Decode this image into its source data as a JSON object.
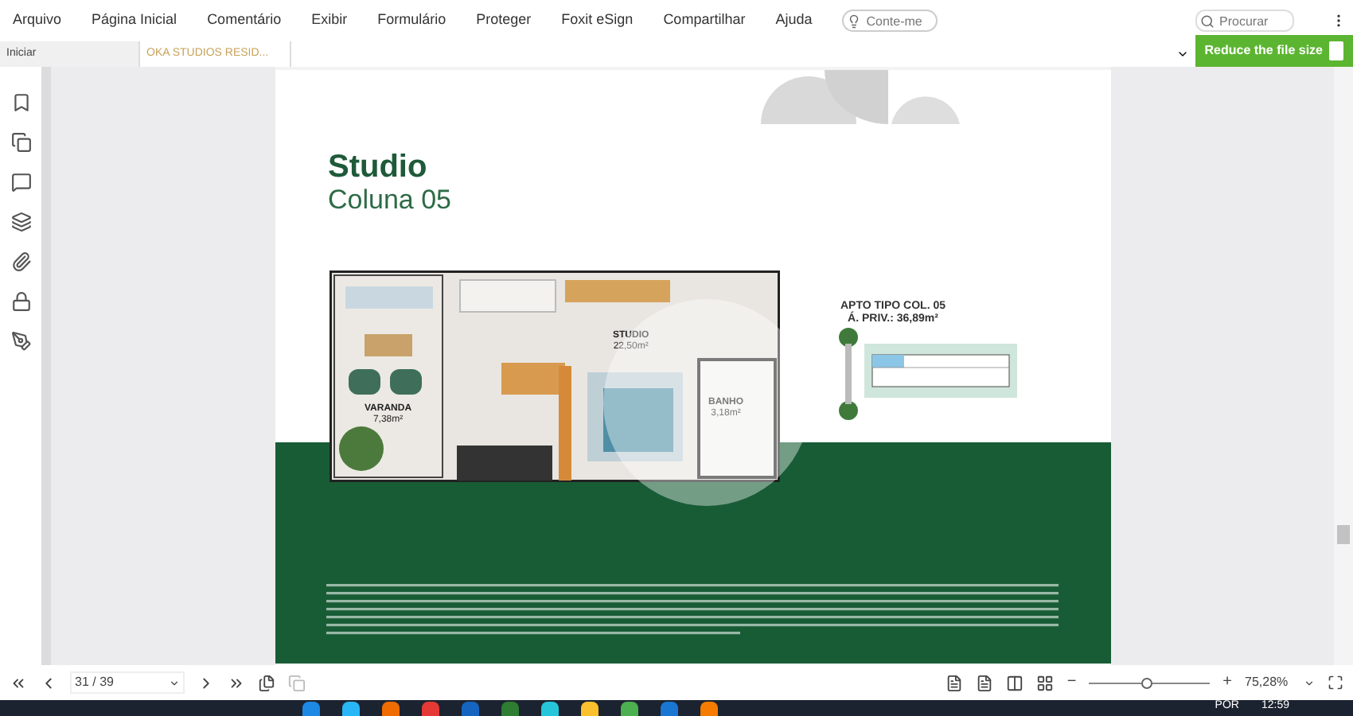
{
  "menu": [
    "Arquivo",
    "Página Inicial",
    "Comentário",
    "Exibir",
    "Formulário",
    "Proteger",
    "Foxit eSign",
    "Compartilhar",
    "Ajuda"
  ],
  "tell_me": {
    "placeholder": "Conte-me"
  },
  "find": {
    "placeholder": "Procurar"
  },
  "tabs": [
    {
      "label": "Iniciar",
      "selected": false
    },
    {
      "label": "OKA STUDIOS RESID...",
      "selected": true
    }
  ],
  "reduce_button": "Reduce the file size",
  "page": {
    "title": "Studio",
    "subtitle": "Coluna 05",
    "rooms": [
      {
        "name": "VARANDA",
        "area": "7,38m²"
      },
      {
        "name": "STUDIO",
        "area": "22,50m²"
      },
      {
        "name": "BANHO",
        "area": "3,18m²"
      }
    ],
    "key_plan": {
      "title": "APTO TIPO COL. 05",
      "area": "Á. PRIV.: 36,89m²"
    }
  },
  "navigation": {
    "page": "31 / 39",
    "zoom_out": "−",
    "zoom_slider": {
      "level": 0.47
    },
    "zoom_in": "+",
    "zoom": "75,28%"
  },
  "taskbar": {
    "language": "POR",
    "time": "12:59"
  }
}
